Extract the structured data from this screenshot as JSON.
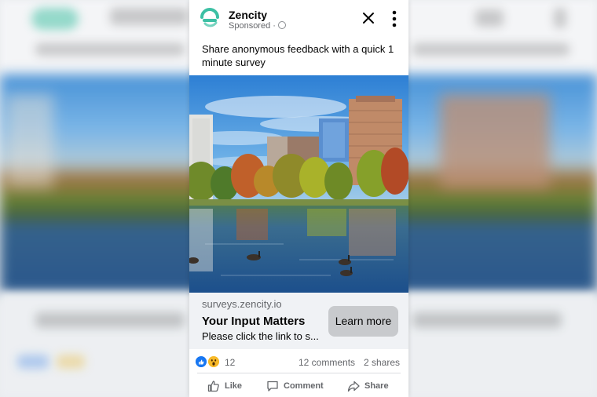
{
  "ad": {
    "brand": "Zencity",
    "sponsored": "Sponsored ·",
    "caption": "Share anonymous feedback with a quick 1 minute survey",
    "domain": "surveys.zencity.io",
    "headline": "Your Input Matters",
    "description": "Please click the link to s...",
    "cta_label": "Learn more"
  },
  "engagement": {
    "reaction_count": "12",
    "comments": "12 comments",
    "shares": "2 shares"
  },
  "actions": {
    "like": "Like",
    "comment": "Comment",
    "share": "Share"
  },
  "colors": {
    "brand_teal": "#3cc0a4",
    "like_blue": "#1877f2",
    "wow_yellow": "#f7b928"
  },
  "icons": [
    "zencity-logo-icon",
    "globe-icon",
    "close-icon",
    "more-options-icon",
    "like-reaction-icon",
    "wow-reaction-icon",
    "thumbs-up-icon",
    "comment-icon",
    "share-icon"
  ]
}
